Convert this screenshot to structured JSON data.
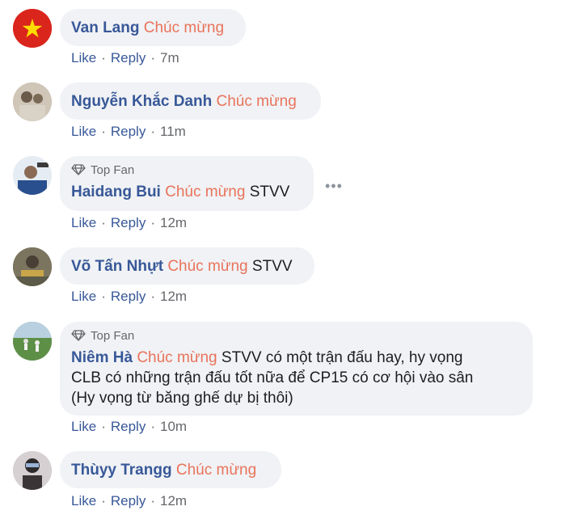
{
  "action_like": "Like",
  "action_reply": "Reply",
  "separator": "·",
  "top_fan_label": "Top Fan",
  "more_options": "•••",
  "colors": {
    "name": "#385898",
    "highlight": "#e9735b",
    "bubble": "#f0f2f5"
  },
  "comments": [
    {
      "name": "Van Lang",
      "highlight": "Chúc mừng",
      "text": "",
      "time": "7m",
      "avatar_icon": "vietnam-flag-icon"
    },
    {
      "name": "Nguyễn Khắc Danh",
      "highlight": "Chúc mừng",
      "text": "",
      "time": "11m",
      "avatar_icon": "user-photo"
    },
    {
      "name": "Haidang Bui",
      "highlight": "Chúc mừng",
      "text": "STVV",
      "time": "12m",
      "top_fan": true,
      "avatar_icon": "user-photo"
    },
    {
      "name": "Võ Tấn Nhựt",
      "highlight": "Chúc mừng",
      "text": "STVV",
      "time": "12m",
      "avatar_icon": "user-photo"
    },
    {
      "name": "Niêm Hà",
      "highlight": "Chúc mừng",
      "text_lines": [
        "STVV có một trận đấu hay, hy vọng",
        "CLB có những trận đấu tốt nữa để CP15 có cơ hội vào sân",
        "(Hy vọng từ băng ghế dự bị thôi)"
      ],
      "time": "10m",
      "top_fan": true,
      "avatar_icon": "user-photo"
    },
    {
      "name": "Thùyy Trangg",
      "highlight": "Chúc mừng",
      "text": "",
      "time": "12m",
      "avatar_icon": "user-photo"
    }
  ]
}
